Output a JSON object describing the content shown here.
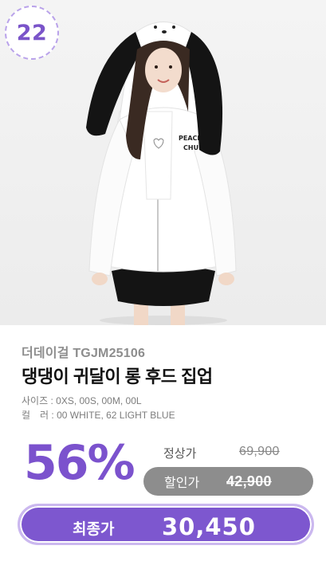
{
  "rank": "22",
  "product": {
    "brand_code": "더데이걸 TGJM25106",
    "title": "댕댕이 귀달이 롱 후드 집업",
    "size_label": "사이즈",
    "size_value": "0XS, 00S, 00M, 00L",
    "color_label": "컬　러",
    "color_value": "00 WHITE, 62 LIGHT BLUE",
    "hoodie_print": "PEACH CHU"
  },
  "pricing": {
    "discount": "56%",
    "regular_label": "정상가",
    "regular_price": "69,900",
    "sale_label": "할인가",
    "sale_price": "42,900",
    "final_label": "최종가",
    "final_price": "30,450"
  },
  "colors": {
    "accent": "#7d57cf",
    "sale_pill": "#8d8d8d",
    "badge_border": "#b9a2ea"
  }
}
